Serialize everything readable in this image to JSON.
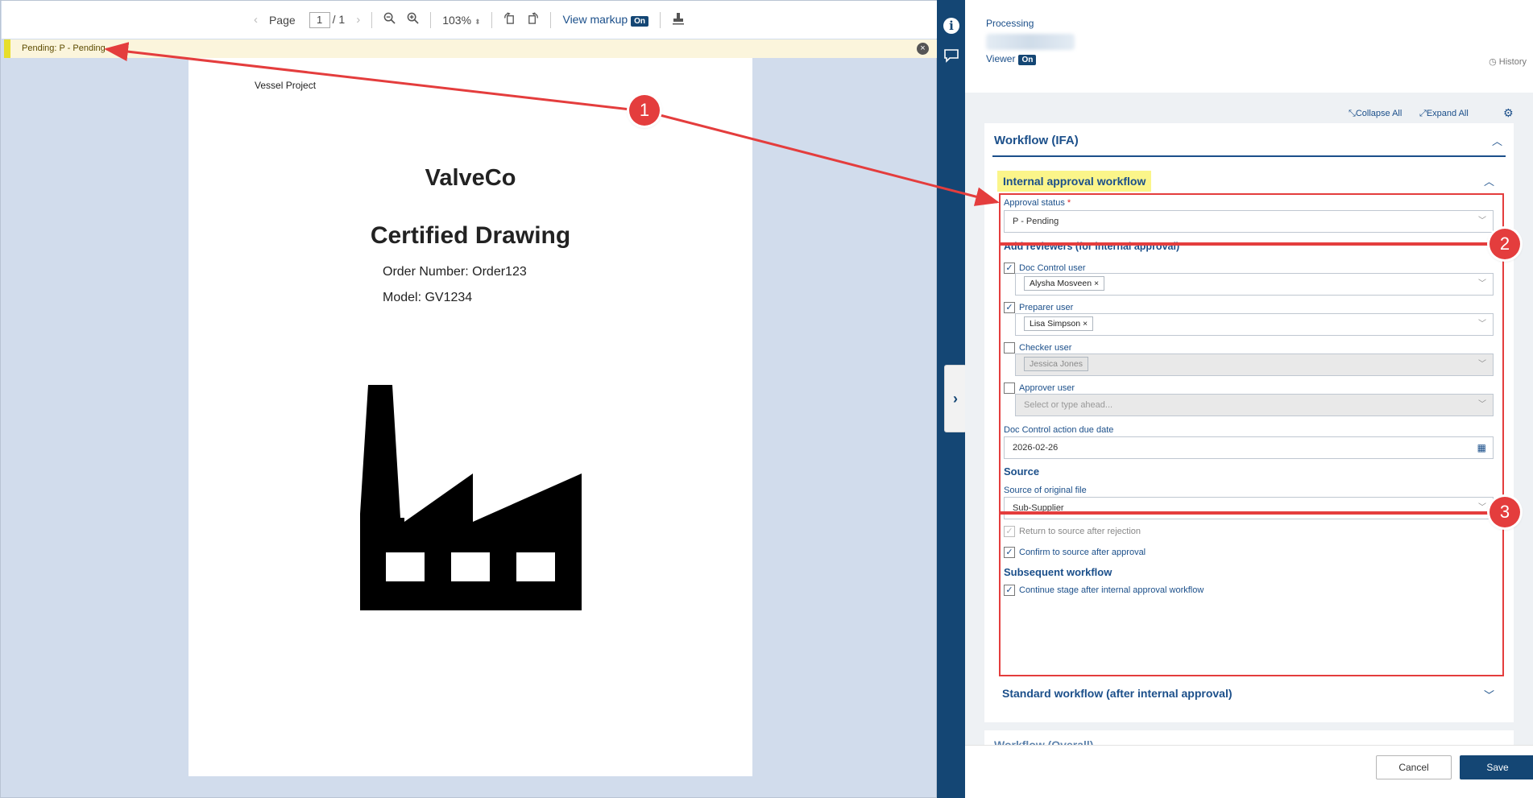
{
  "toolbar": {
    "page_label": "Page",
    "page_current": "1",
    "page_total": "/ 1",
    "zoom": "103%",
    "view_markup_label": "View markup",
    "view_markup_state": "On"
  },
  "banner": {
    "text": "Pending: P - Pending",
    "close_glyph": "×"
  },
  "document": {
    "project": "Vessel Project",
    "company": "ValveCo",
    "title": "Certified Drawing",
    "order": "Order Number: Order123",
    "model": "Model: GV1234"
  },
  "rail": {
    "info_icon": "info-icon",
    "comment_icon": "comment-icon",
    "expand_glyph": "›"
  },
  "panel": {
    "processing": "Processing",
    "viewer_label": "Viewer",
    "viewer_state": "On",
    "history": "History",
    "collapse_all": "Collapse All",
    "expand_all": "Expand All",
    "workflow_title": "Workflow (IFA)",
    "internal_title": "Internal approval workflow",
    "approval_status_label": "Approval status",
    "approval_status_value": "P - Pending",
    "reviewers_section": "Add reviewers (for internal approval)",
    "doc_control_label": "Doc Control user",
    "doc_control_value": "Alysha Mosveen",
    "preparer_label": "Preparer user",
    "preparer_value": "Lisa Simpson",
    "checker_label": "Checker user",
    "checker_value": "Jessica Jones",
    "approver_label": "Approver user",
    "approver_placeholder": "Select or type ahead...",
    "due_date_label": "Doc Control action due date",
    "due_date_value": "2026-02-26",
    "source_section": "Source",
    "source_label": "Source of original file",
    "source_value": "Sub-Supplier",
    "return_label": "Return to source after rejection",
    "confirm_label": "Confirm to source after approval",
    "subsequent_section": "Subsequent workflow",
    "continue_label": "Continue stage after internal approval workflow",
    "standard_title": "Standard workflow (after internal approval)",
    "overall_title": "Workflow (Overall)",
    "cancel": "Cancel",
    "save": "Save"
  },
  "annotations": {
    "marker_1": "1",
    "marker_2": "2",
    "marker_3": "3"
  },
  "colors": {
    "brand": "#144674",
    "annotation": "#e43d3d",
    "highlight": "#fbf58a"
  }
}
